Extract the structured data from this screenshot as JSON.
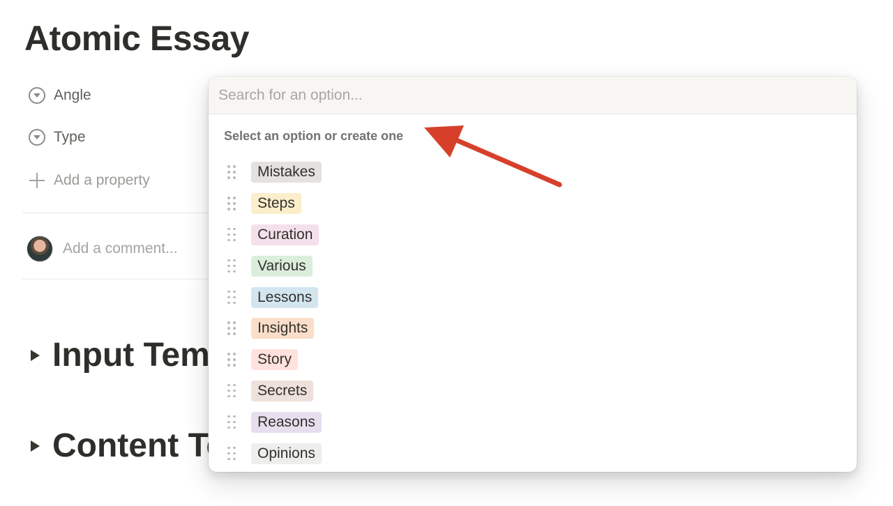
{
  "page": {
    "title": "Atomic Essay",
    "properties": [
      {
        "label": "Angle",
        "icon": "select-circle-icon"
      },
      {
        "label": "Type",
        "icon": "select-circle-icon"
      }
    ],
    "add_property_label": "Add a property",
    "comment_placeholder": "Add a comment...",
    "toggle_headings": [
      "Input Temp",
      "Content Te"
    ]
  },
  "dropdown": {
    "search_placeholder": "Search for an option...",
    "hint": "Select an option or create one",
    "options": [
      {
        "label": "Mistakes",
        "color": "#e3e2e0"
      },
      {
        "label": "Steps",
        "color": "#fbeecb"
      },
      {
        "label": "Curation",
        "color": "#f4e0ea"
      },
      {
        "label": "Various",
        "color": "#dbeddb"
      },
      {
        "label": "Lessons",
        "color": "#d3e5ef"
      },
      {
        "label": "Insights",
        "color": "#fadec9"
      },
      {
        "label": "Story",
        "color": "#ffe2dd"
      },
      {
        "label": "Secrets",
        "color": "#eee0da"
      },
      {
        "label": "Reasons",
        "color": "#e8deee"
      },
      {
        "label": "Opinions",
        "color": "#eeeeed"
      }
    ]
  },
  "annotation": {
    "arrow_color": "#d6402b"
  }
}
